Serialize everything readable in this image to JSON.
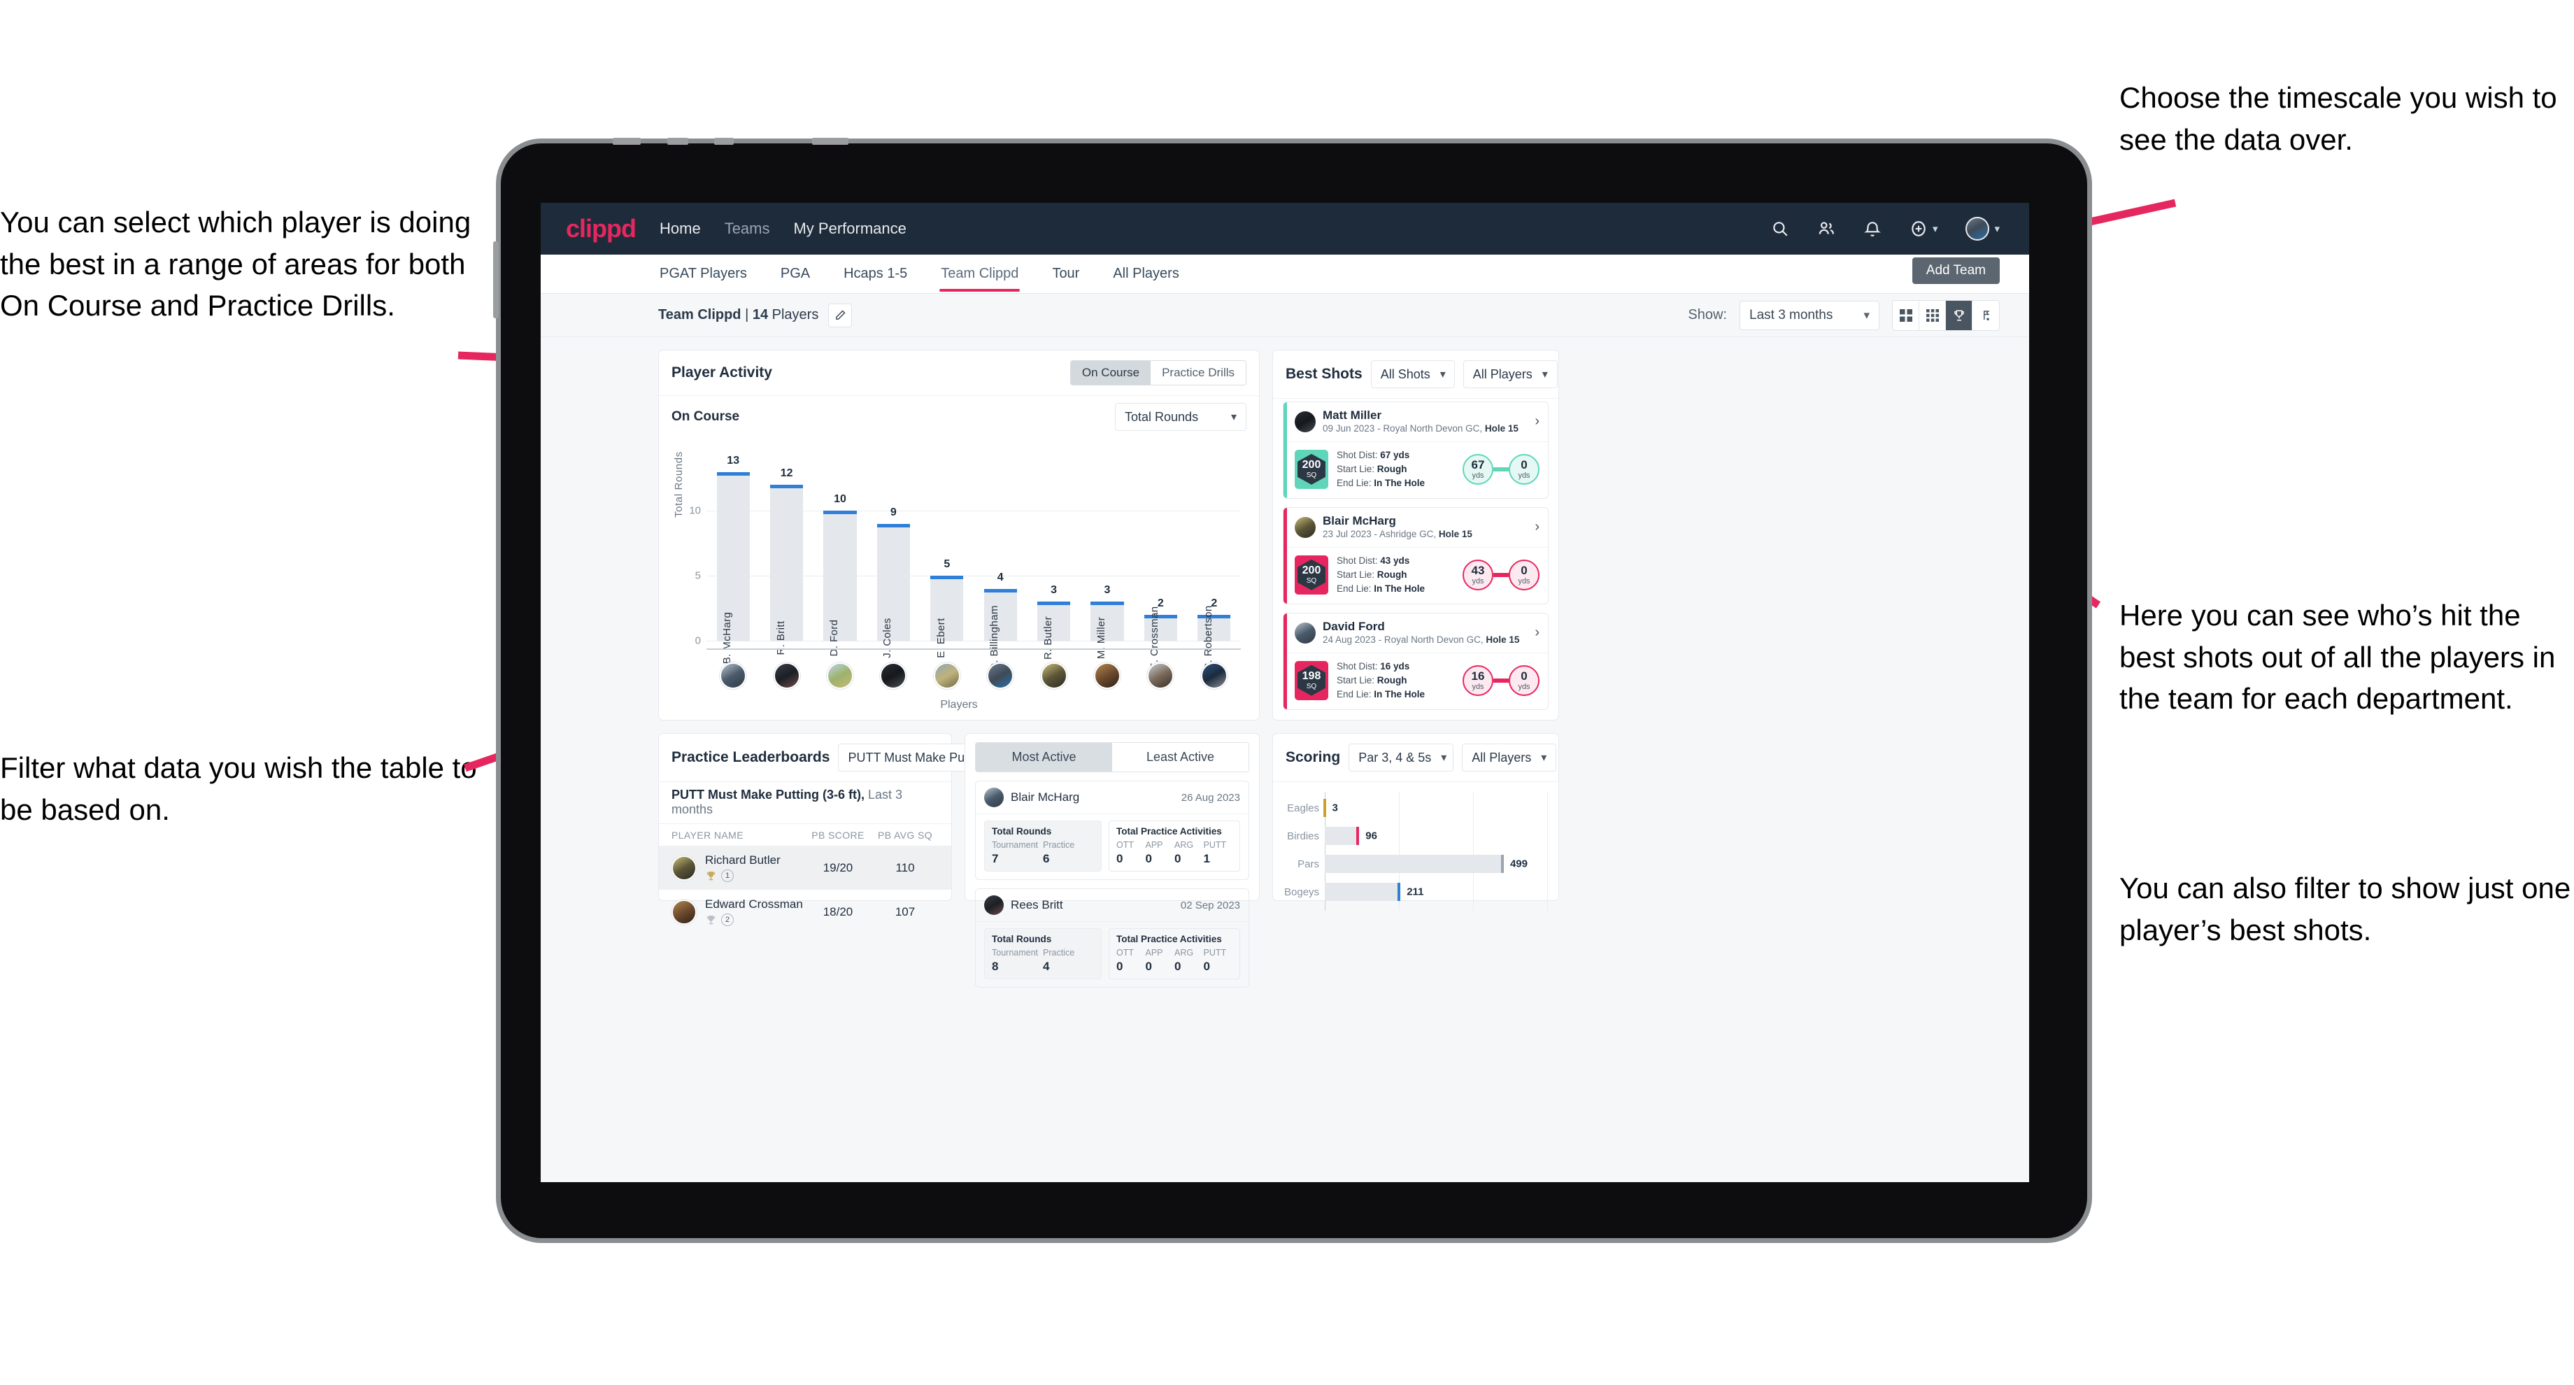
{
  "annotations": {
    "left_top": "You can select which player is doing the best in a range of areas for both On Course and Practice Drills.",
    "left_bottom": "Filter what data you wish the table to be based on.",
    "right_top": "Choose the timescale you wish to see the data over.",
    "right_middle": "Here you can see who’s hit the best shots out of all the players in the team for each department.",
    "right_bottom": "You can also filter to show just one player’s best shots.",
    "arrow_color": "#e6275f"
  },
  "topnav": {
    "brand": "clippd",
    "links": [
      {
        "label": "Home",
        "active": true
      },
      {
        "label": "Teams",
        "active": false
      },
      {
        "label": "My Performance",
        "active": true
      }
    ],
    "icons": [
      "search-icon",
      "people-icon",
      "bell-icon",
      "plus-circle-icon",
      "avatar"
    ],
    "background": "#1d2b3a",
    "brand_color": "#e6275f"
  },
  "tabs": {
    "items": [
      {
        "label": "PGAT Players",
        "active": false
      },
      {
        "label": "PGA",
        "active": false
      },
      {
        "label": "Hcaps 1-5",
        "active": false
      },
      {
        "label": "Team Clippd",
        "active": true
      },
      {
        "label": "Tour",
        "active": false
      },
      {
        "label": "All Players",
        "active": false
      }
    ],
    "add_team_tooltip": "Add Team"
  },
  "subbar": {
    "team_name": "Team Clippd",
    "team_separator": " | ",
    "player_count": "14",
    "players_word": " Players",
    "edit_icon": "pencil-icon",
    "show_label": "Show:",
    "timescale_value": "Last 3 months",
    "view_buttons": [
      {
        "icon": "grid-4-icon",
        "active": false
      },
      {
        "icon": "grid-9-icon",
        "active": false
      },
      {
        "icon": "trophy-icon",
        "active": true
      },
      {
        "icon": "flag-golf-icon",
        "active": false
      }
    ]
  },
  "player_activity": {
    "title": "Player Activity",
    "segments": [
      {
        "label": "On Course",
        "active": true
      },
      {
        "label": "Practice Drills",
        "active": false
      }
    ],
    "sub_label": "On Course",
    "metric_value": "Total Rounds"
  },
  "chart_data": [
    {
      "type": "bar",
      "title": "Player Activity — On Course",
      "xlabel": "Players",
      "ylabel": "Total Rounds",
      "categories": [
        "B. McHarg",
        "R. Britt",
        "D. Ford",
        "J. Coles",
        "E. Ebert",
        "D. Billingham",
        "R. Butler",
        "M. Miller",
        "E. Crossman",
        "C. Robertson"
      ],
      "values": [
        13,
        12,
        10,
        9,
        5,
        4,
        3,
        3,
        2,
        2
      ],
      "ylim": [
        0,
        14
      ],
      "yticks": [
        0,
        5,
        10
      ],
      "bar_color": "#e4e7eb",
      "cap_color": "#2f7ed8",
      "grid": true
    },
    {
      "type": "bar",
      "orientation": "horizontal",
      "title": "Scoring",
      "categories": [
        "Eagles",
        "Birdies",
        "Pars",
        "Bogeys"
      ],
      "values": [
        3,
        96,
        499,
        211
      ],
      "tip_colors": [
        "#c9a227",
        "#e6275f",
        "#9aa5b1",
        "#2f7ed8"
      ],
      "xlim": [
        0,
        620
      ],
      "grid": true
    }
  ],
  "best_shots": {
    "title": "Best Shots",
    "filter_shots": "All Shots",
    "filter_players": "All Players",
    "shots": [
      {
        "name": "Matt Miller",
        "date": "09 Jun 2023",
        "course": " - Royal North Devon GC, ",
        "hole": "Hole 15",
        "sq": "200",
        "sq_unit": "SQ",
        "accent": "#5fd6ba",
        "shot_dist_label": "Shot Dist: ",
        "shot_dist": "67 yds",
        "start_lie_label": "Start Lie: ",
        "start_lie": "Rough",
        "end_lie_label": "End Lie: ",
        "end_lie": "In The Hole",
        "from_value": "67",
        "from_unit": "yds",
        "to_value": "0",
        "to_unit": "yds"
      },
      {
        "name": "Blair McHarg",
        "date": "23 Jul 2023",
        "course": " - Ashridge GC, ",
        "hole": "Hole 15",
        "sq": "200",
        "sq_unit": "SQ",
        "accent": "#e6275f",
        "shot_dist_label": "Shot Dist: ",
        "shot_dist": "43 yds",
        "start_lie_label": "Start Lie: ",
        "start_lie": "Rough",
        "end_lie_label": "End Lie: ",
        "end_lie": "In The Hole",
        "from_value": "43",
        "from_unit": "yds",
        "to_value": "0",
        "to_unit": "yds"
      },
      {
        "name": "David Ford",
        "date": "24 Aug 2023",
        "course": " - Royal North Devon GC, ",
        "hole": "Hole 15",
        "sq": "198",
        "sq_unit": "SQ",
        "accent": "#e6275f",
        "shot_dist_label": "Shot Dist: ",
        "shot_dist": "16 yds",
        "start_lie_label": "Start Lie: ",
        "start_lie": "Rough",
        "end_lie_label": "End Lie: ",
        "end_lie": "In The Hole",
        "from_value": "16",
        "from_unit": "yds",
        "to_value": "0",
        "to_unit": "yds"
      }
    ]
  },
  "practice_leaderboards": {
    "title": "Practice Leaderboards",
    "drill_select": "PUTT Must Make Putting ...",
    "subtitle_bold": "PUTT Must Make Putting (3-6 ft),",
    "subtitle_rest": " Last 3 months",
    "columns": [
      "PLAYER NAME",
      "PB SCORE",
      "PB AVG SQ"
    ],
    "rows": [
      {
        "name": "Richard Butler",
        "rank": "1",
        "trophy": "gold",
        "pb_score": "19/20",
        "pb_avg_sq": "110",
        "highlight": true
      },
      {
        "name": "Edward Crossman",
        "rank": "2",
        "trophy": "silver",
        "pb_score": "18/20",
        "pb_avg_sq": "107",
        "highlight": false
      }
    ]
  },
  "activity_panel": {
    "tabs": [
      {
        "label": "Most Active",
        "active": true
      },
      {
        "label": "Least Active",
        "active": false
      }
    ],
    "cards": [
      {
        "name": "Blair McHarg",
        "date": "26 Aug 2023",
        "rounds_title": "Total Rounds",
        "rounds_cols": [
          "Tournament",
          "Practice"
        ],
        "rounds_vals": [
          "7",
          "6"
        ],
        "practice_title": "Total Practice Activities",
        "practice_cols": [
          "OTT",
          "APP",
          "ARG",
          "PUTT"
        ],
        "practice_vals": [
          "0",
          "0",
          "0",
          "1"
        ]
      },
      {
        "name": "Rees Britt",
        "date": "02 Sep 2023",
        "rounds_title": "Total Rounds",
        "rounds_cols": [
          "Tournament",
          "Practice"
        ],
        "rounds_vals": [
          "8",
          "4"
        ],
        "practice_title": "Total Practice Activities",
        "practice_cols": [
          "OTT",
          "APP",
          "ARG",
          "PUTT"
        ],
        "practice_vals": [
          "0",
          "0",
          "0",
          "0"
        ]
      }
    ]
  },
  "scoring": {
    "title": "Scoring",
    "filter_par": "Par 3, 4 & 5s",
    "filter_players": "All Players"
  }
}
